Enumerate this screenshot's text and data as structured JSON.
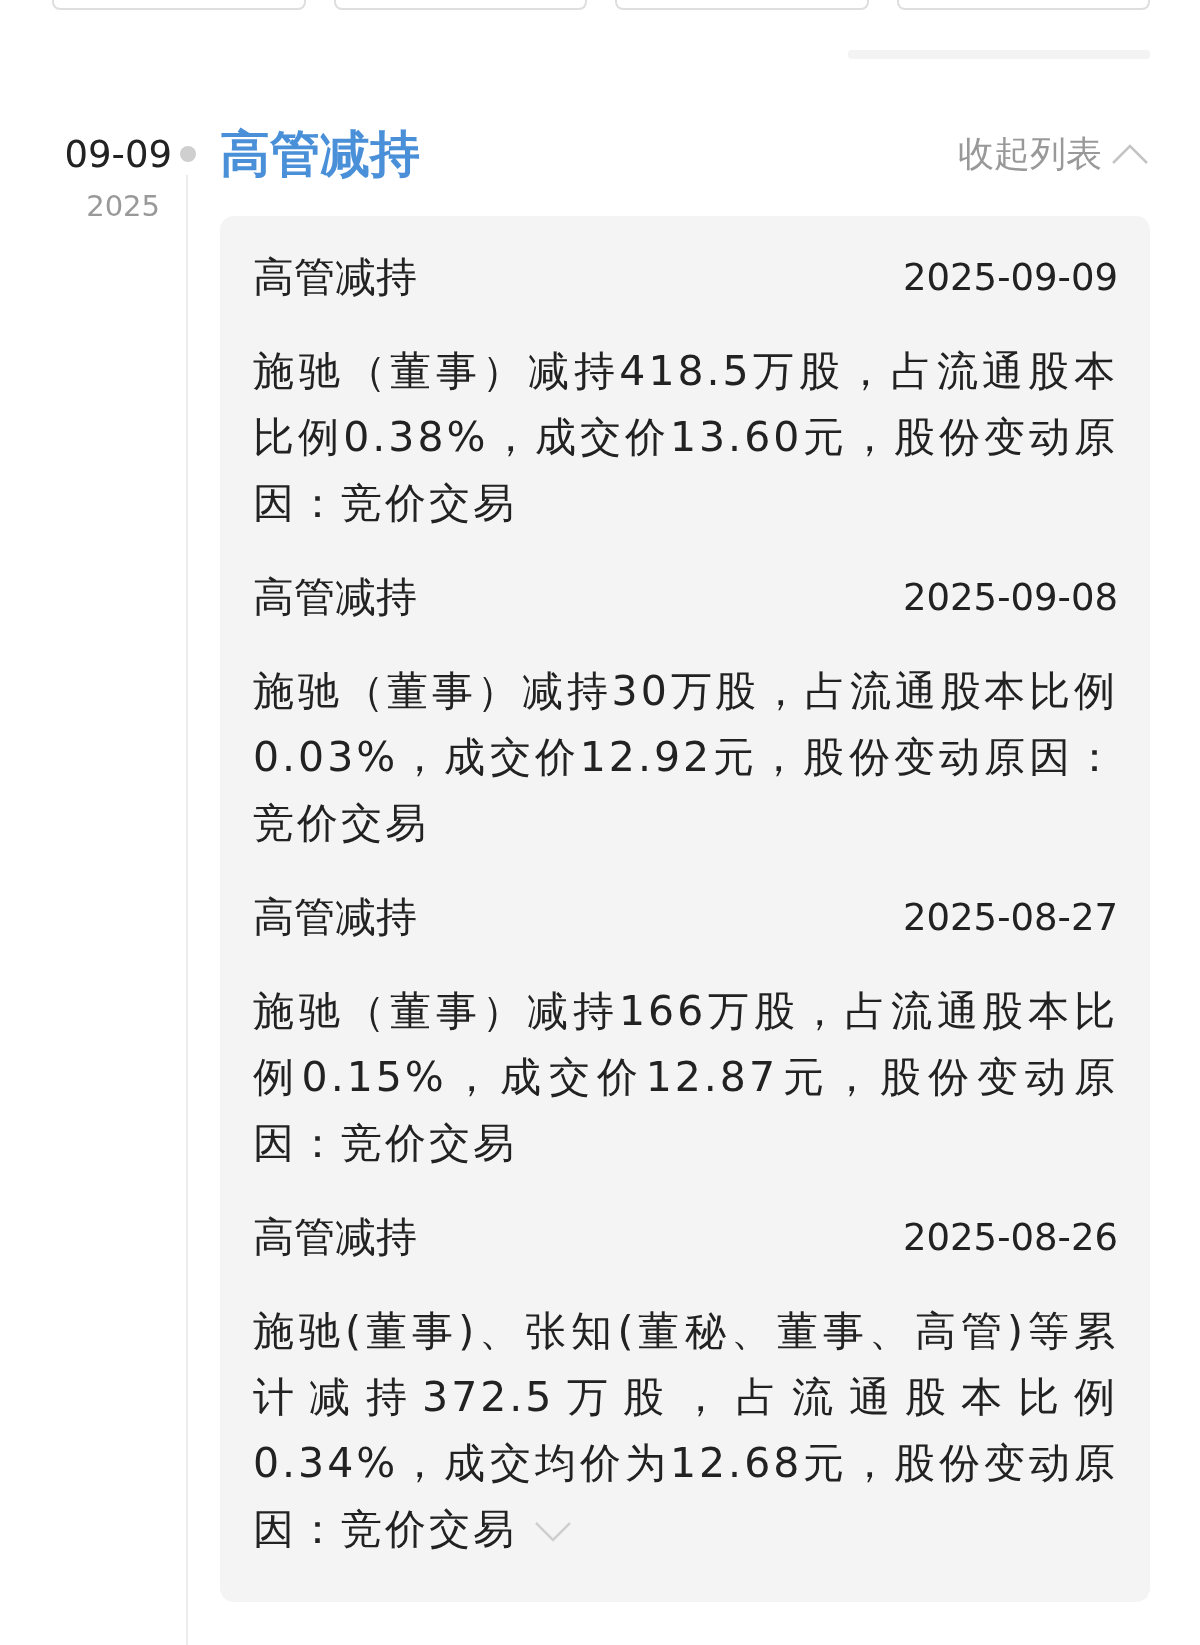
{
  "group": {
    "date": "09-09",
    "year": "2025",
    "title": "高管减持",
    "toggle_label": "收起列表",
    "expanded": true,
    "records": [
      {
        "title": "高管减持",
        "date": "2025-09-09",
        "text": "施驰（董事）减持418.5万股，占流通股本比例0.38%，成交价13.60元，股份变动原因：竞价交易",
        "truncated": false
      },
      {
        "title": "高管减持",
        "date": "2025-09-08",
        "text": "施驰（董事）减持30万股，占流通股本比例0.03%，成交价12.92元，股份变动原因：竞价交易",
        "truncated": false
      },
      {
        "title": "高管减持",
        "date": "2025-08-27",
        "text": "施驰（董事）减持166万股，占流通股本比例0.15%，成交价12.87元，股份变动原因：竞价交易",
        "truncated": false
      },
      {
        "title": "高管减持",
        "date": "2025-08-26",
        "text": "施驰(董事)、张知(董秘、董事、高管)等累计减持372.5万股，占流通股本比例0.34%，成交均价为12.68元，股份变动原因：竞价交易",
        "truncated": true
      }
    ]
  }
}
